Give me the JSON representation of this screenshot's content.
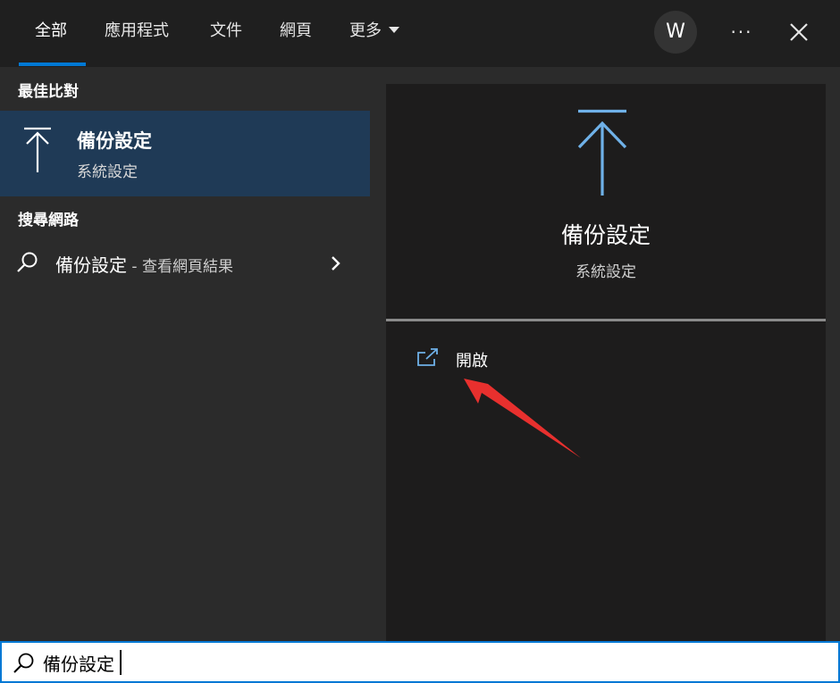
{
  "tabs": [
    {
      "label": "全部",
      "active": true
    },
    {
      "label": "應用程式"
    },
    {
      "label": "文件"
    },
    {
      "label": "網頁"
    },
    {
      "label": "更多"
    }
  ],
  "account": {
    "initial": "W"
  },
  "more_options_glyph": "···",
  "best_match": {
    "header": "最佳比對",
    "title": "備份設定",
    "subtitle": "系統設定",
    "icon": "upload-arrow-icon"
  },
  "web_search": {
    "header": "搜尋網路",
    "query": "備份設定",
    "suffix": " - 查看網頁結果"
  },
  "detail": {
    "title": "備份設定",
    "subtitle": "系統設定",
    "actions": [
      {
        "label": "開啟",
        "icon": "open-external-icon"
      }
    ]
  },
  "search": {
    "value": "備份設定"
  },
  "colors": {
    "accent": "#0078d4",
    "icon_blue": "#6fb1e8",
    "selected_bg": "#1f3a56",
    "annotation_red": "#e8302e"
  }
}
